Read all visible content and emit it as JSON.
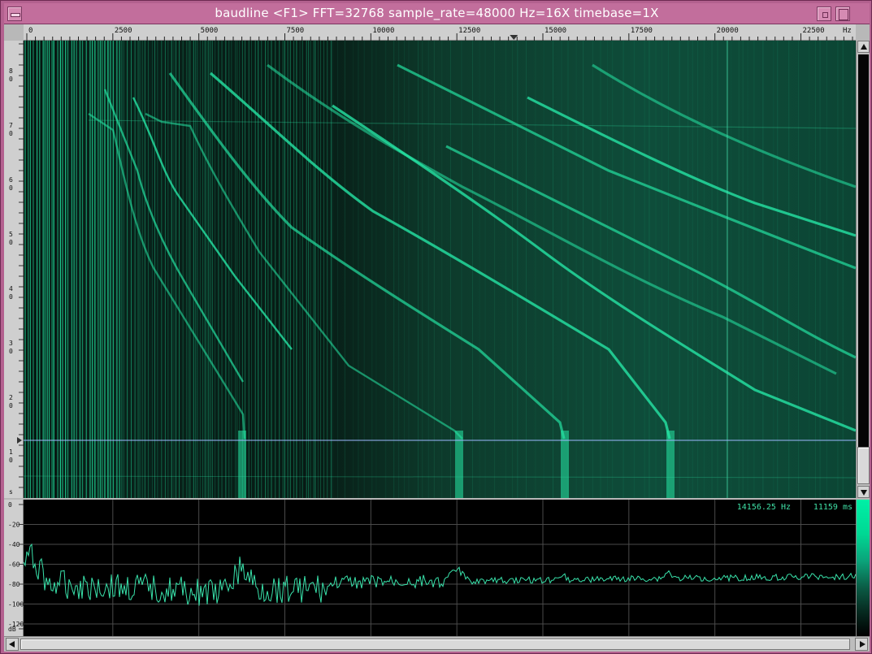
{
  "window": {
    "title": "baudline  <F1> FFT=32768 sample_rate=48000 Hz=16X timebase=1X"
  },
  "frequency_axis": {
    "unit": "Hz",
    "ticks": [
      "0",
      "2500",
      "5000",
      "7500",
      "10000",
      "12500",
      "15000",
      "17500",
      "20000",
      "22500"
    ],
    "max_hz": 24000
  },
  "time_axis": {
    "ticks": [
      "8\n0",
      "7\n0",
      "6\n0",
      "5\n0",
      "4\n0",
      "3\n0",
      "2\n0",
      "1\n0",
      "s"
    ]
  },
  "db_axis": {
    "ticks": [
      "0",
      "-20",
      "-40",
      "-60",
      "-80",
      "-100",
      "-120",
      "dB"
    ]
  },
  "spectrum_readout": {
    "frequency": "14156.25 Hz",
    "time": "11159 ms"
  },
  "colors": {
    "spectral_trace": "#39e3ab",
    "spectrogram_accent": "#00d894",
    "cursor_line": "#9db9ff",
    "window_frame": "#b3618f"
  },
  "icons": {
    "menu": "window-menu-icon",
    "minimize": "minimize-icon",
    "maximize": "maximize-icon",
    "close": "close-icon",
    "frequency_marker": "down-triangle-marker-icon",
    "time_marker": "right-triangle-marker-icon"
  }
}
